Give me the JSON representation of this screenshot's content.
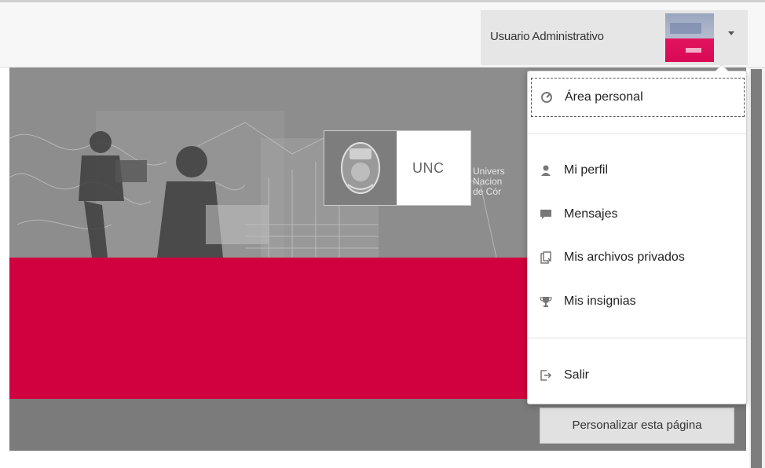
{
  "header": {
    "user_name": "Usuario Administrativo",
    "avatar_alt": "avatar"
  },
  "banner": {
    "logo_text": "UNC",
    "university_lines": [
      "Univers",
      "Nacion",
      "de Cór"
    ],
    "colors": {
      "red": "#d1003f",
      "grey": "#8d8d8d",
      "dark_grey": "#7b7b7b"
    }
  },
  "user_menu": {
    "items": [
      {
        "label": "Área personal",
        "icon": "dashboard-icon"
      },
      {
        "label": "Mi perfil",
        "icon": "user-icon"
      },
      {
        "label": "Mensajes",
        "icon": "message-icon"
      },
      {
        "label": "Mis archivos privados",
        "icon": "files-icon"
      },
      {
        "label": "Mis insignias",
        "icon": "trophy-icon"
      },
      {
        "label": "Salir",
        "icon": "logout-icon"
      }
    ]
  },
  "page": {
    "customize_button": "Personalizar esta página"
  }
}
